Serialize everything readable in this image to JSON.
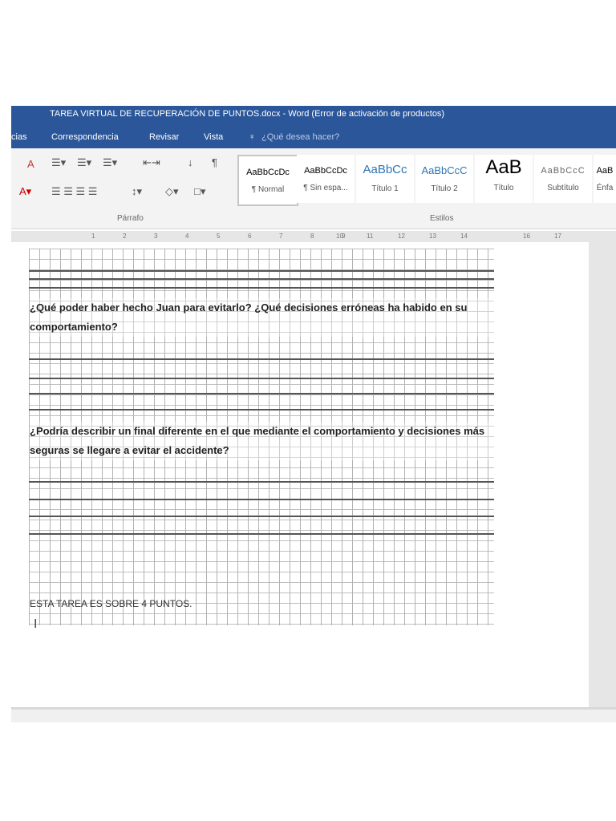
{
  "window": {
    "title": "TAREA VIRTUAL DE RECUPERACIÓN DE PUNTOS.docx - Word (Error de activación de productos)"
  },
  "tabs": [
    "cias",
    "Correspondencia",
    "Revisar",
    "Vista"
  ],
  "search": {
    "placeholder": "¿Qué desea hacer?"
  },
  "ribbon": {
    "groups": [
      "Párrafo",
      "Estilos"
    ],
    "styles": [
      {
        "preview": "AaBbCcDc",
        "name": "¶ Normal"
      },
      {
        "preview": "AaBbCcDc",
        "name": "¶ Sin espa..."
      },
      {
        "preview": "AaBbCc",
        "name": "Título 1"
      },
      {
        "preview": "AaBbCcC",
        "name": "Título 2"
      },
      {
        "preview": "AaB",
        "name": "Título"
      },
      {
        "preview": "AaBbCcC",
        "name": "Subtítulo"
      },
      {
        "preview": "AaB",
        "name": "Énfa"
      }
    ]
  },
  "ruler": [
    "1",
    "2",
    "3",
    "4",
    "5",
    "6",
    "7",
    "8",
    "9",
    "10",
    "11",
    "12",
    "13",
    "14",
    "16",
    "17"
  ],
  "document": {
    "q1": "¿Qué poder haber hecho Juan para evitarlo? ¿Qué decisiones erróneas ha habido en su comportamiento?",
    "q2": "¿Podría describir un final diferente en el que mediante el comportamiento y decisiones más seguras se llegare a evitar el accidente?",
    "footer": "ESTA TAREA ES SOBRE 4 PUNTOS."
  }
}
